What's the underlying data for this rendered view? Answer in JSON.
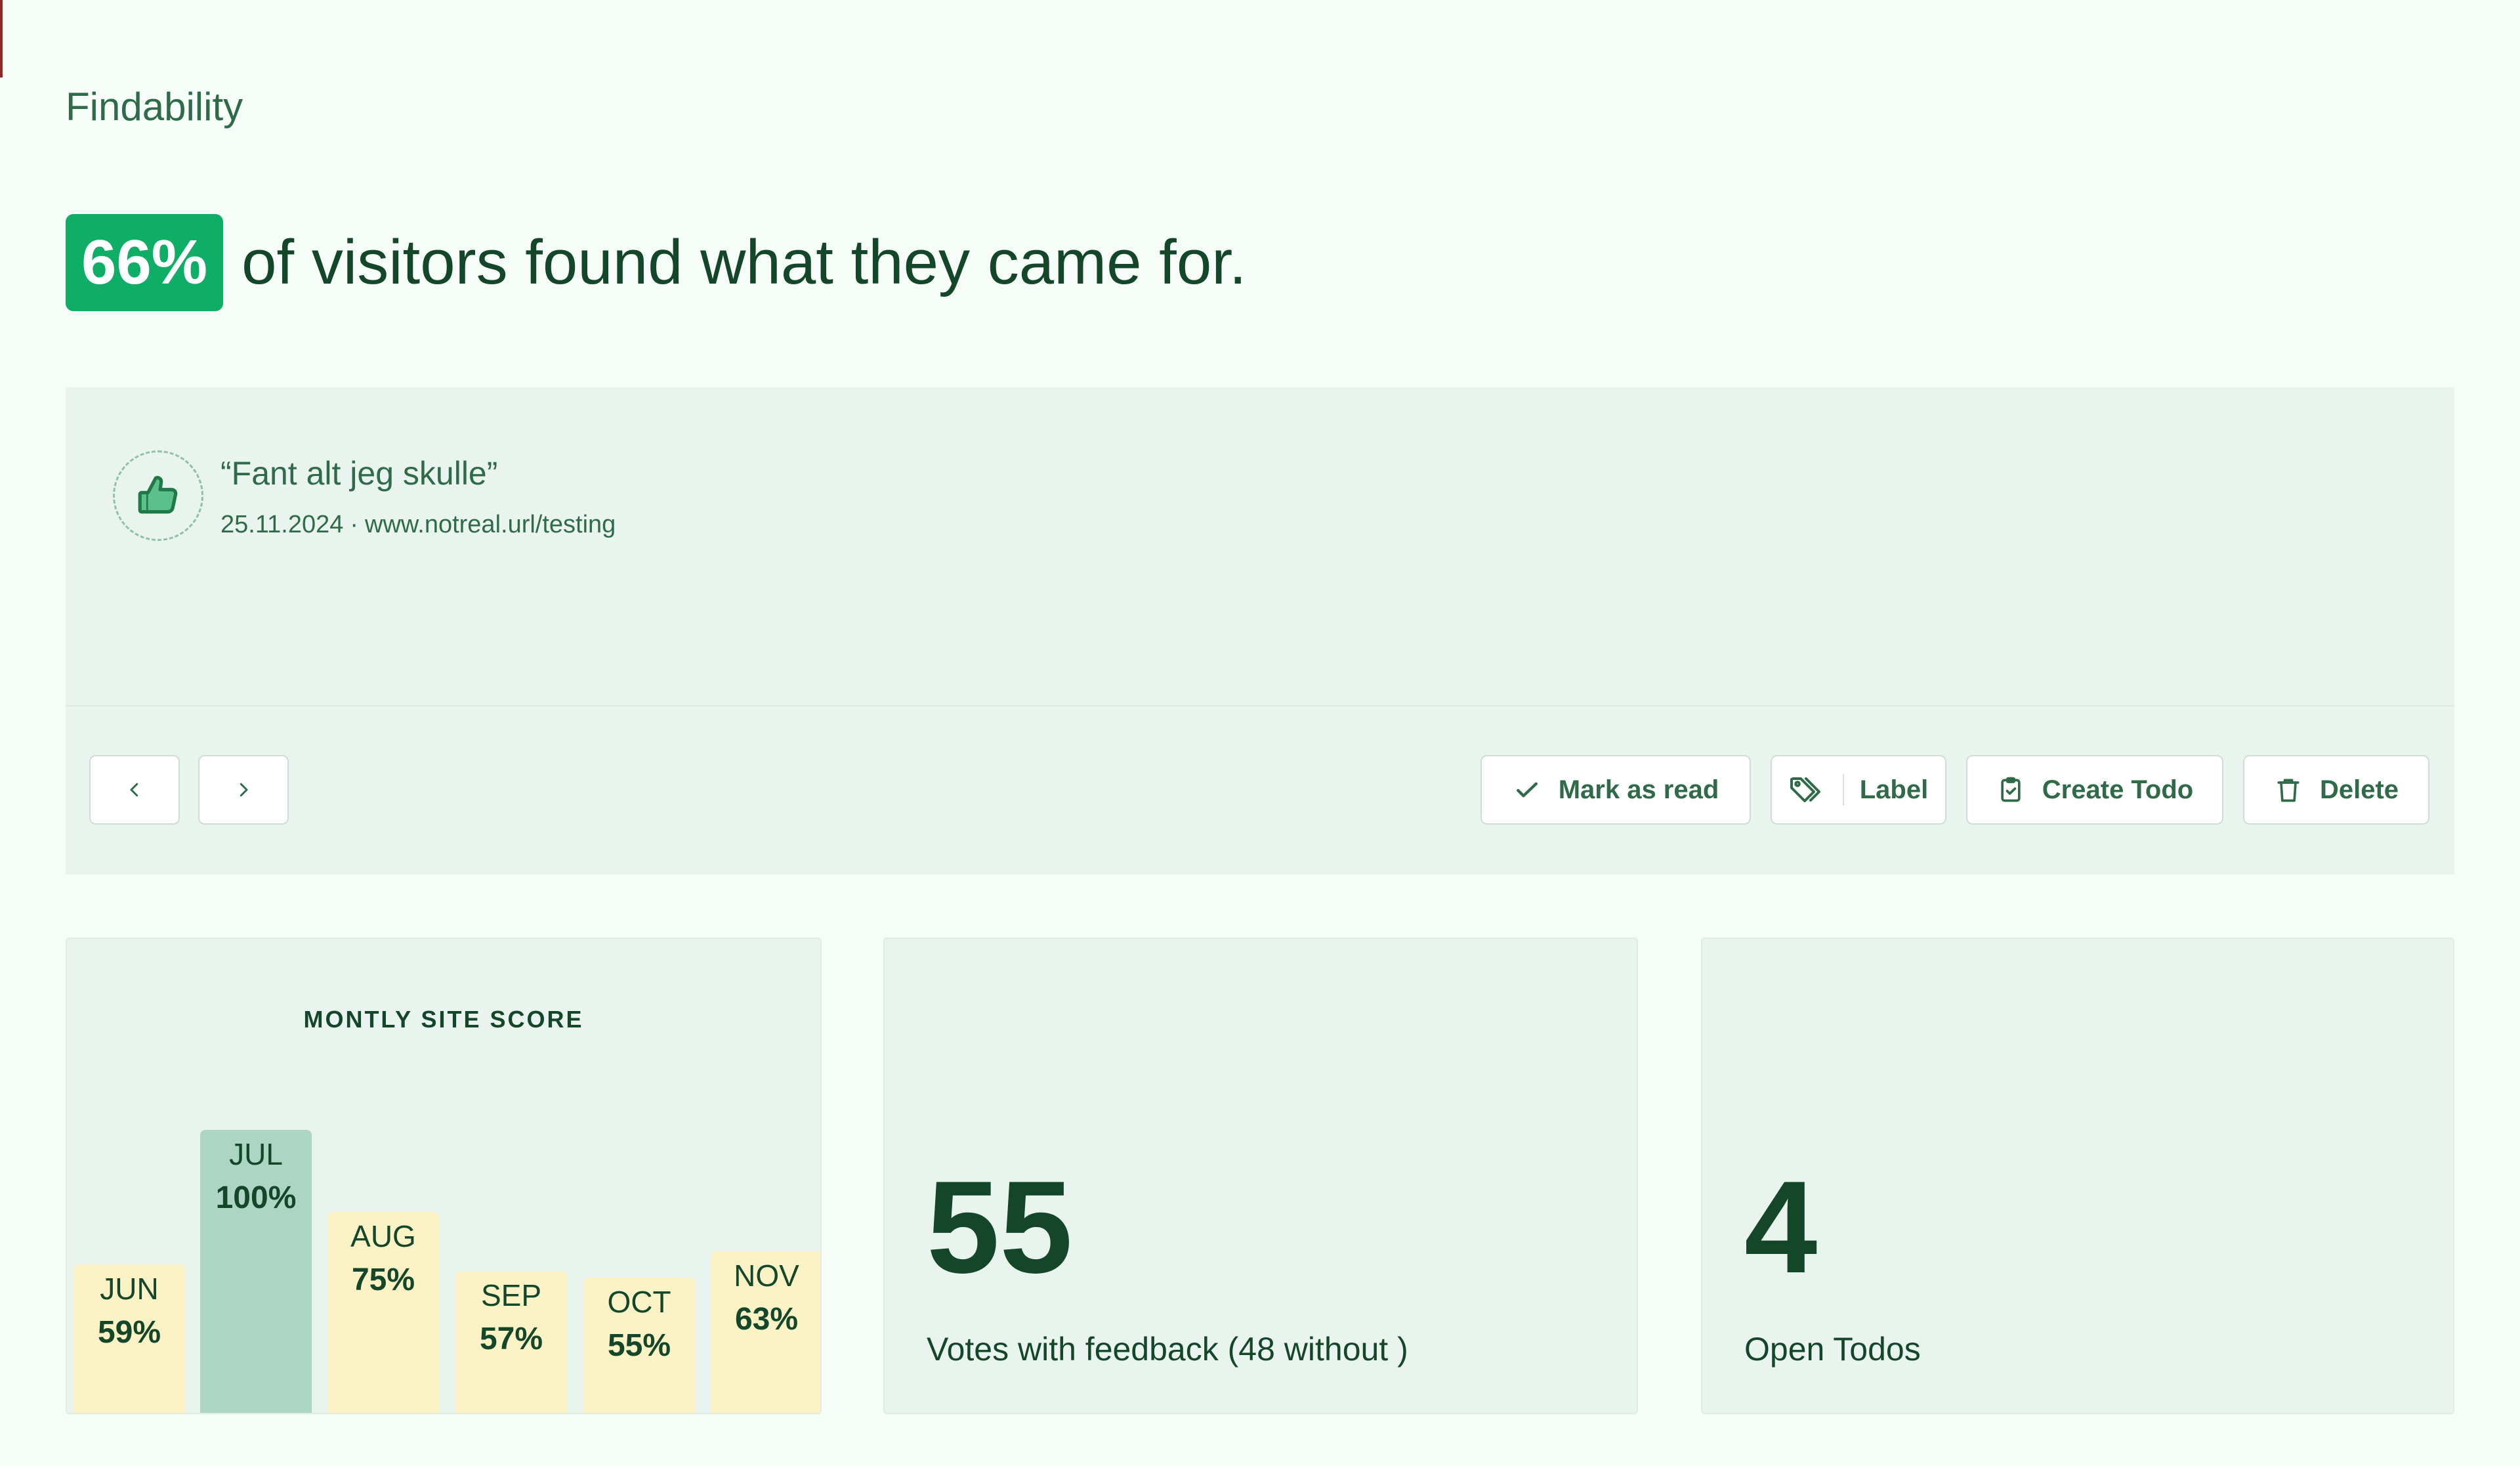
{
  "section_title": "Findability",
  "headline": {
    "percent": "66%",
    "text": "of visitors found what they came for."
  },
  "feedback": {
    "icon": "thumbs-up-icon",
    "quote": "“Fant alt jeg skulle”",
    "date": "25.11.2024",
    "separator": "·",
    "url": "www.notreal.url/testing"
  },
  "nav": {
    "prev_icon": "chevron-left-icon",
    "next_icon": "chevron-right-icon"
  },
  "actions": {
    "mark_as_read": "Mark as read",
    "label": "Label",
    "create_todo": "Create Todo",
    "delete": "Delete"
  },
  "colors": {
    "accent": "#0fae67",
    "text_dark": "#14462a",
    "panel_bg": "#eaf4ef",
    "bar_default": "#fbf3c6",
    "bar_highlight": "#acd5c4"
  },
  "chart_data": {
    "type": "bar",
    "title": "MONTLY SITE SCORE",
    "categories": [
      "JUN",
      "JUL",
      "AUG",
      "SEP",
      "OCT",
      "NOV"
    ],
    "values": [
      59,
      100,
      75,
      57,
      55,
      63
    ],
    "value_labels": [
      "59%",
      "100%",
      "75%",
      "57%",
      "55%",
      "63%"
    ],
    "highlight": "JUL",
    "ylim": [
      0,
      100
    ],
    "grid": false
  },
  "stats": {
    "votes": {
      "value": "55",
      "label": "Votes with feedback (48 without )"
    },
    "todos": {
      "value": "4",
      "label": "Open Todos"
    }
  }
}
